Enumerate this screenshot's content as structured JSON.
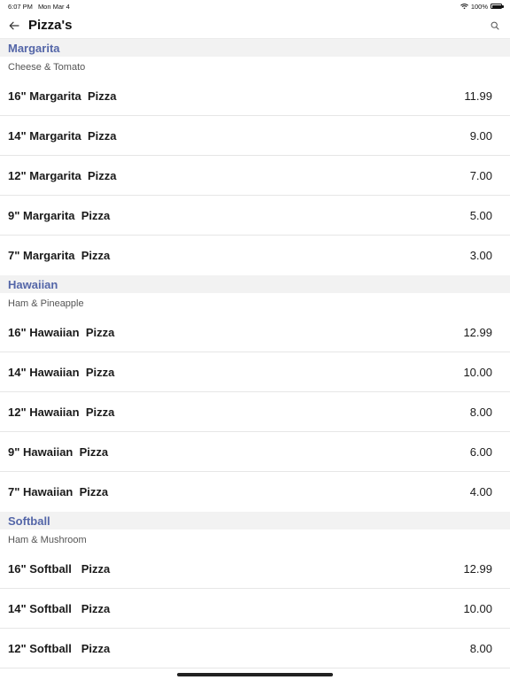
{
  "status": {
    "time": "6:07 PM",
    "date": "Mon Mar 4",
    "battery": "100%"
  },
  "header": {
    "title": "Pizza's"
  },
  "sections": [
    {
      "title": "Margarita",
      "subtitle": "Cheese & Tomato",
      "items": [
        {
          "name": "16\" Margarita  Pizza",
          "price": "11.99"
        },
        {
          "name": "14\" Margarita  Pizza",
          "price": "9.00"
        },
        {
          "name": "12\" Margarita  Pizza",
          "price": "7.00"
        },
        {
          "name": "9\" Margarita  Pizza",
          "price": "5.00"
        },
        {
          "name": "7\" Margarita  Pizza",
          "price": "3.00"
        }
      ]
    },
    {
      "title": "Hawaiian",
      "subtitle": "Ham & Pineapple",
      "items": [
        {
          "name": "16\" Hawaiian  Pizza",
          "price": "12.99"
        },
        {
          "name": "14\" Hawaiian  Pizza",
          "price": "10.00"
        },
        {
          "name": "12\" Hawaiian  Pizza",
          "price": "8.00"
        },
        {
          "name": "9\" Hawaiian  Pizza",
          "price": "6.00"
        },
        {
          "name": "7\" Hawaiian  Pizza",
          "price": "4.00"
        }
      ]
    },
    {
      "title": "Softball",
      "subtitle": "Ham & Mushroom",
      "items": [
        {
          "name": "16\" Softball   Pizza",
          "price": "12.99"
        },
        {
          "name": "14\" Softball   Pizza",
          "price": "10.00"
        },
        {
          "name": "12\" Softball   Pizza",
          "price": "8.00"
        }
      ]
    }
  ]
}
